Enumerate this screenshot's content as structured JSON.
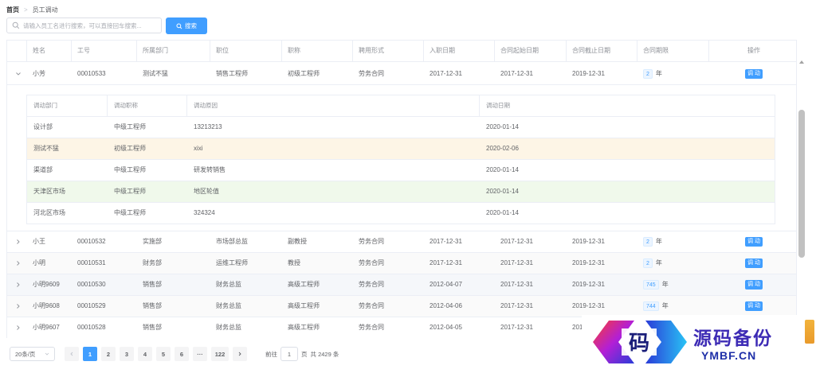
{
  "breadcrumb": {
    "home": "首页",
    "separator": ">",
    "current": "员工调动"
  },
  "search": {
    "placeholder": "请输入员工名进行搜索，可以直接回车搜索...",
    "value": "",
    "button_label": "搜索"
  },
  "colors": {
    "primary": "#409eff",
    "warning_row": "#fdf5e6",
    "success_row": "#f0f9eb",
    "tag_bg": "#ecf5ff"
  },
  "table": {
    "columns": [
      "姓名",
      "工号",
      "所属部门",
      "职位",
      "职称",
      "聘用形式",
      "入职日期",
      "合同起始日期",
      "合同截止日期",
      "合同期限",
      "操作"
    ],
    "action_label": "调 动",
    "year_unit": "年",
    "rows": [
      {
        "name": "小芳",
        "id": "00010533",
        "dept": "测试不猛",
        "position": "销售工程师",
        "title": "初级工程师",
        "employ": "劳务合同",
        "entry": "2017-12-31",
        "start": "2017-12-31",
        "end": "2019-12-31",
        "term": "2",
        "expanded": true
      },
      {
        "name": "小王",
        "id": "00010532",
        "dept": "实施部",
        "position": "市场部总监",
        "title": "副教授",
        "employ": "劳务合同",
        "entry": "2017-12-31",
        "start": "2017-12-31",
        "end": "2019-12-31",
        "term": "2"
      },
      {
        "name": "小明",
        "id": "00010531",
        "dept": "财务部",
        "position": "运维工程师",
        "title": "教授",
        "employ": "劳务合同",
        "entry": "2017-12-31",
        "start": "2017-12-31",
        "end": "2019-12-31",
        "term": "2"
      },
      {
        "name": "小明9609",
        "id": "00010530",
        "dept": "销售部",
        "position": "财务总监",
        "title": "高级工程师",
        "employ": "劳务合同",
        "entry": "2012-04-07",
        "start": "2017-12-31",
        "end": "2019-12-31",
        "term": "745"
      },
      {
        "name": "小明9608",
        "id": "00010529",
        "dept": "销售部",
        "position": "财务总监",
        "title": "高级工程师",
        "employ": "劳务合同",
        "entry": "2012-04-06",
        "start": "2017-12-31",
        "end": "2019-12-31",
        "term": "744"
      },
      {
        "name": "小明9607",
        "id": "00010528",
        "dept": "销售部",
        "position": "财务总监",
        "title": "高级工程师",
        "employ": "劳务合同",
        "entry": "2012-04-05",
        "start": "2017-12-31",
        "end": "201",
        "term": ""
      }
    ]
  },
  "transfer": {
    "columns": [
      "调动部门",
      "调动职称",
      "调动原因",
      "调动日期"
    ],
    "rows": [
      {
        "dept": "设计部",
        "title": "中级工程师",
        "reason": "13213213",
        "date": "2020-01-14"
      },
      {
        "dept": "测试不猛",
        "title": "初级工程师",
        "reason": "xixi",
        "date": "2020-02-06"
      },
      {
        "dept": "渠道部",
        "title": "中级工程师",
        "reason": "研发转销售",
        "date": "2020-01-14"
      },
      {
        "dept": "天津区市场",
        "title": "中级工程师",
        "reason": "地区轮值",
        "date": "2020-01-14"
      },
      {
        "dept": "河北区市场",
        "title": "中级工程师",
        "reason": "324324",
        "date": "2020-01-14"
      }
    ]
  },
  "pagination": {
    "page_size": "20条/页",
    "pages": [
      "1",
      "2",
      "3",
      "4",
      "5",
      "6",
      "···",
      "122"
    ],
    "current": "1",
    "goto_label": "前往",
    "goto_value": "1",
    "page_suffix": "页",
    "total": "共 2429 条"
  },
  "watermark": {
    "logo_char": "码",
    "title": "源码备份",
    "url": "YMBF.CN"
  }
}
